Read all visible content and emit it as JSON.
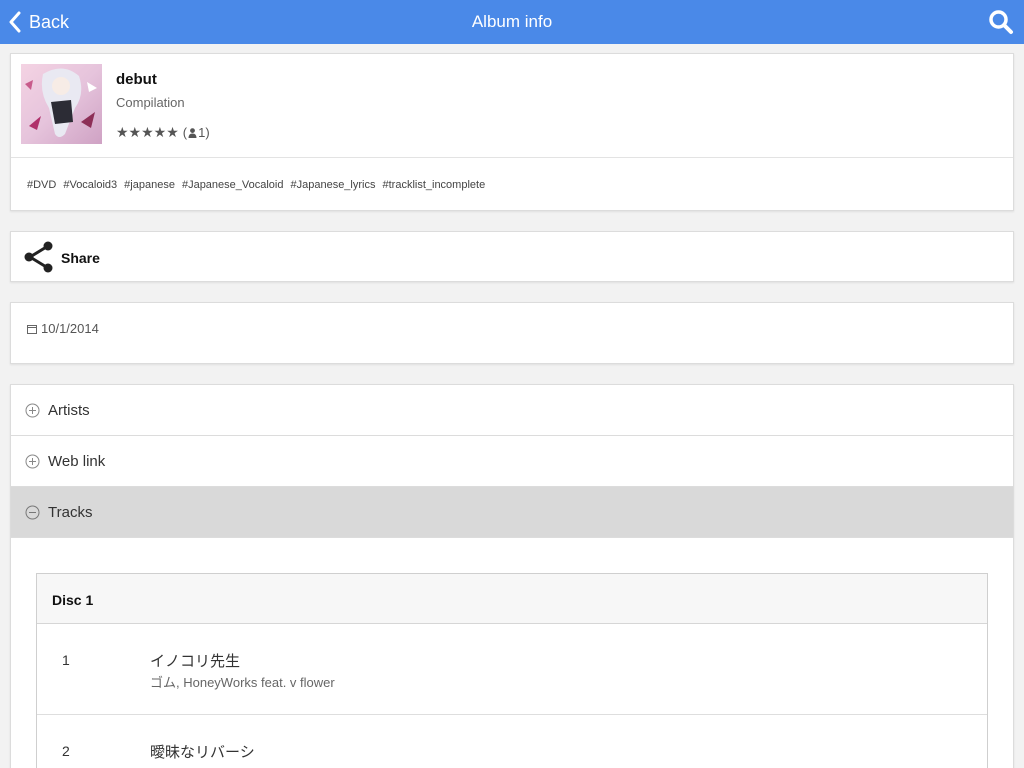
{
  "header": {
    "back_label": "Back",
    "title": "Album info",
    "accent_color": "#4a89e8"
  },
  "album": {
    "name": "debut",
    "type": "Compilation",
    "stars": "★★★★★",
    "rating_open": "(",
    "rating_count": "1)",
    "tags": [
      "#DVD",
      "#Vocaloid3",
      "#japanese",
      "#Japanese_Vocaloid",
      "#Japanese_lyrics",
      "#tracklist_incomplete"
    ]
  },
  "share": {
    "label": "Share"
  },
  "release": {
    "date": "10/1/2014"
  },
  "sections": {
    "artists": "Artists",
    "web_link": "Web link",
    "tracks": "Tracks"
  },
  "discs": [
    {
      "title": "Disc 1",
      "tracks": [
        {
          "number": "1",
          "name": "イノコリ先生",
          "artists": "ゴム, HoneyWorks feat. v flower"
        },
        {
          "number": "2",
          "name": "曖昧なリバーシ",
          "artists": ""
        }
      ]
    }
  ]
}
